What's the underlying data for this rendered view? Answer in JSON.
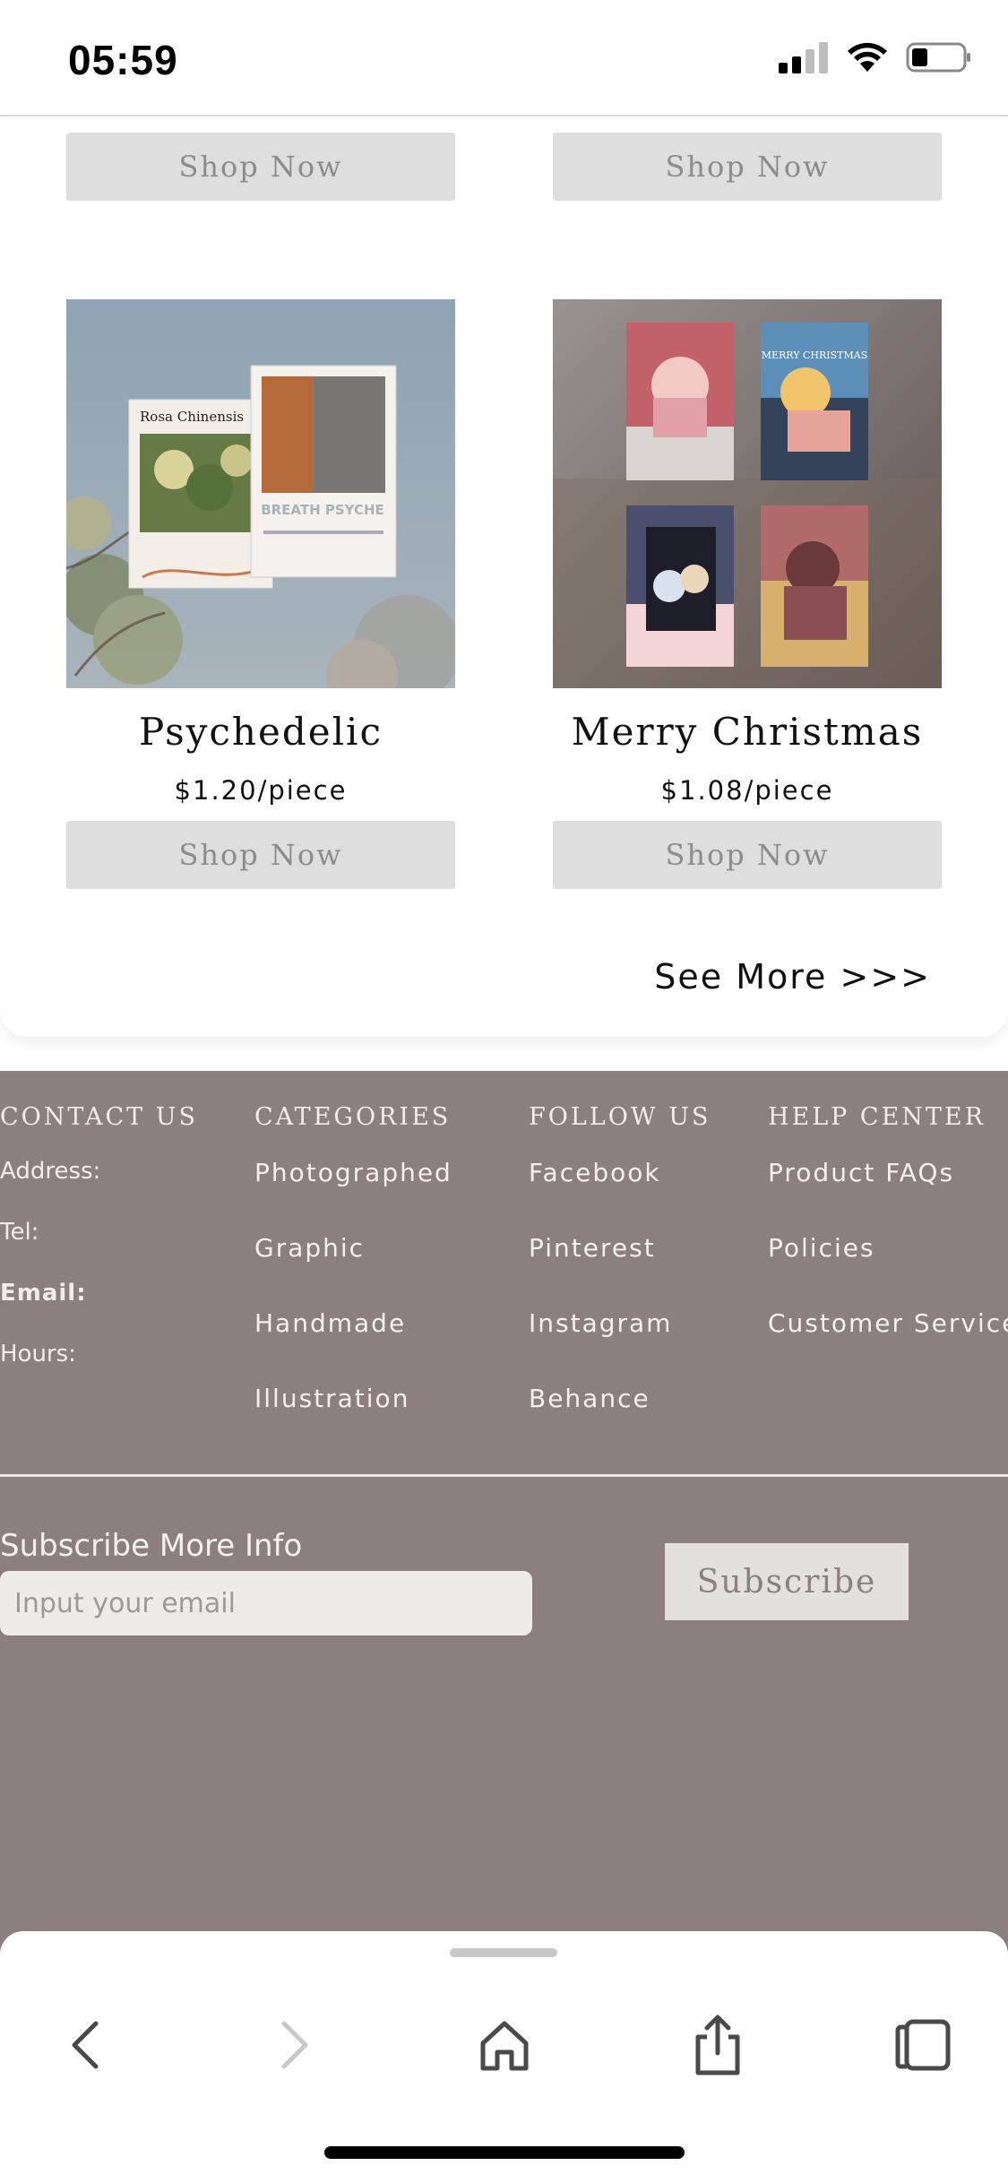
{
  "status_bar": {
    "time": "05:59",
    "icons": [
      "signal-icon",
      "wifi-icon",
      "battery-icon"
    ]
  },
  "products": {
    "top_row_buttons": [
      "Shop Now",
      "Shop Now"
    ],
    "items": [
      {
        "title": "Psychedelic",
        "price": "$1.20/piece",
        "button": "Shop Now",
        "image_text": {
          "poster_a": "Rosa Chinensis",
          "poster_b": "BREATH PSYCHE"
        }
      },
      {
        "title": "Merry Christmas",
        "price": "$1.08/piece",
        "button": "Shop Now",
        "image_text": {
          "card": "MERRY CHRISTMAS"
        }
      }
    ],
    "see_more": "See More >>>"
  },
  "footer": {
    "contact": {
      "heading": "CONTACT US",
      "items": [
        "Address:",
        "Tel:",
        "Email:",
        "Hours:"
      ]
    },
    "categories": {
      "heading": "CATEGORIES",
      "links": [
        "Photographed",
        "Graphic",
        "Handmade",
        "Illustration"
      ]
    },
    "follow": {
      "heading": "FOLLOW US",
      "links": [
        "Facebook",
        "Pinterest",
        "Instagram",
        "Behance"
      ]
    },
    "help": {
      "heading": "HELP CENTER",
      "links": [
        "Product FAQs",
        "Policies",
        "Customer Service"
      ]
    },
    "subscribe": {
      "label": "Subscribe More Info",
      "placeholder": "Input your email",
      "button": "Subscribe"
    }
  },
  "toolbar": {
    "icons": [
      "back-icon",
      "forward-icon",
      "home-icon",
      "share-icon",
      "tabs-icon"
    ]
  },
  "colors": {
    "footer_bg": "#8c7f81",
    "button_bg": "#dedede",
    "button_text": "#8c8c8c"
  }
}
